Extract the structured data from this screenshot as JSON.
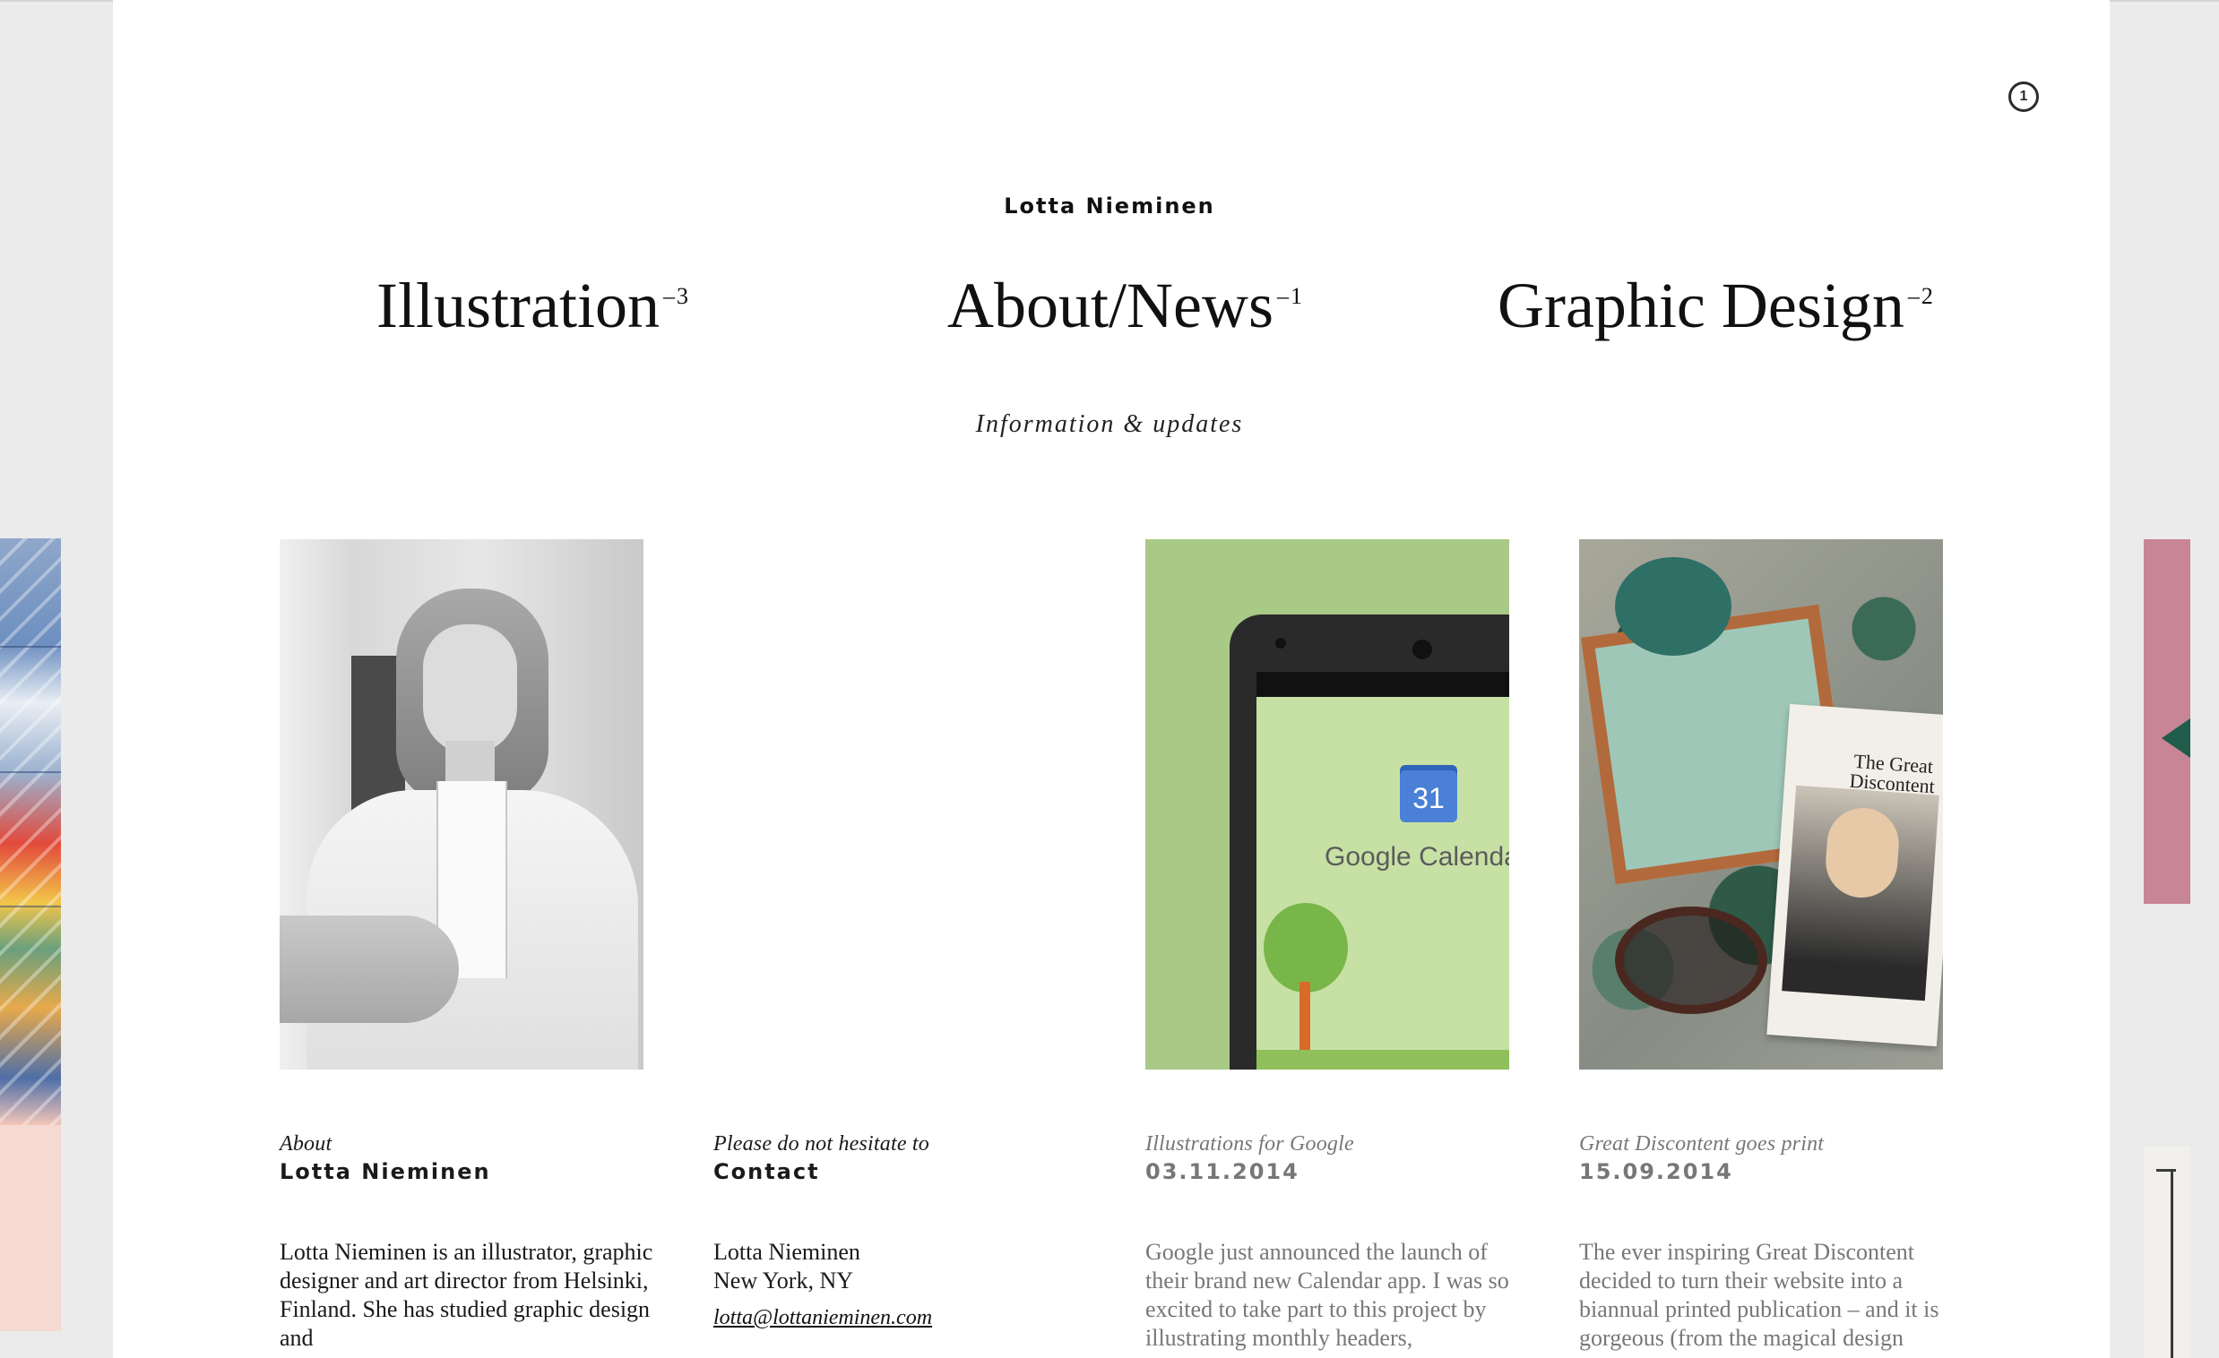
{
  "header": {
    "site_title": "Lotta Nieminen",
    "counter": "1",
    "subtitle": "Information & updates"
  },
  "nav": [
    {
      "label": "Illustration",
      "count": "–3"
    },
    {
      "label": "About/News",
      "count": "–1"
    },
    {
      "label": "Graphic Design",
      "count": "–2"
    }
  ],
  "google_image": {
    "calendar_day": "31",
    "app_name": "Google Calenda"
  },
  "gd_image": {
    "magazine_title": "The Great Discontent"
  },
  "columns": [
    {
      "kicker": "About",
      "heading": "Lotta Nieminen",
      "body": "Lotta Nieminen is an illustrator, graphic designer and art director from Helsinki, Finland. She has studied graphic design and"
    },
    {
      "kicker": "Please do not hesitate to",
      "heading": "Contact",
      "body_lines": [
        "Lotta Nieminen",
        "New York, NY"
      ],
      "email": "lotta@lottanieminen.com"
    },
    {
      "kicker": "Illustrations for Google",
      "heading": "03.11.2014",
      "body": "Google just announced the launch of their brand new Calendar app. I was so excited to take part to this project by illustrating monthly headers,"
    },
    {
      "kicker": "Great Discontent goes print",
      "heading": "15.09.2014",
      "body": "The ever inspiring Great Discontent decided to turn their website into a biannual printed publication – and it is gorgeous (from the magical design"
    }
  ],
  "colors": {
    "background": "#ebebeb",
    "panel": "#ffffff",
    "text": "#1a1a1a",
    "muted_text": "#777777",
    "peek_pink": "#c78595"
  }
}
